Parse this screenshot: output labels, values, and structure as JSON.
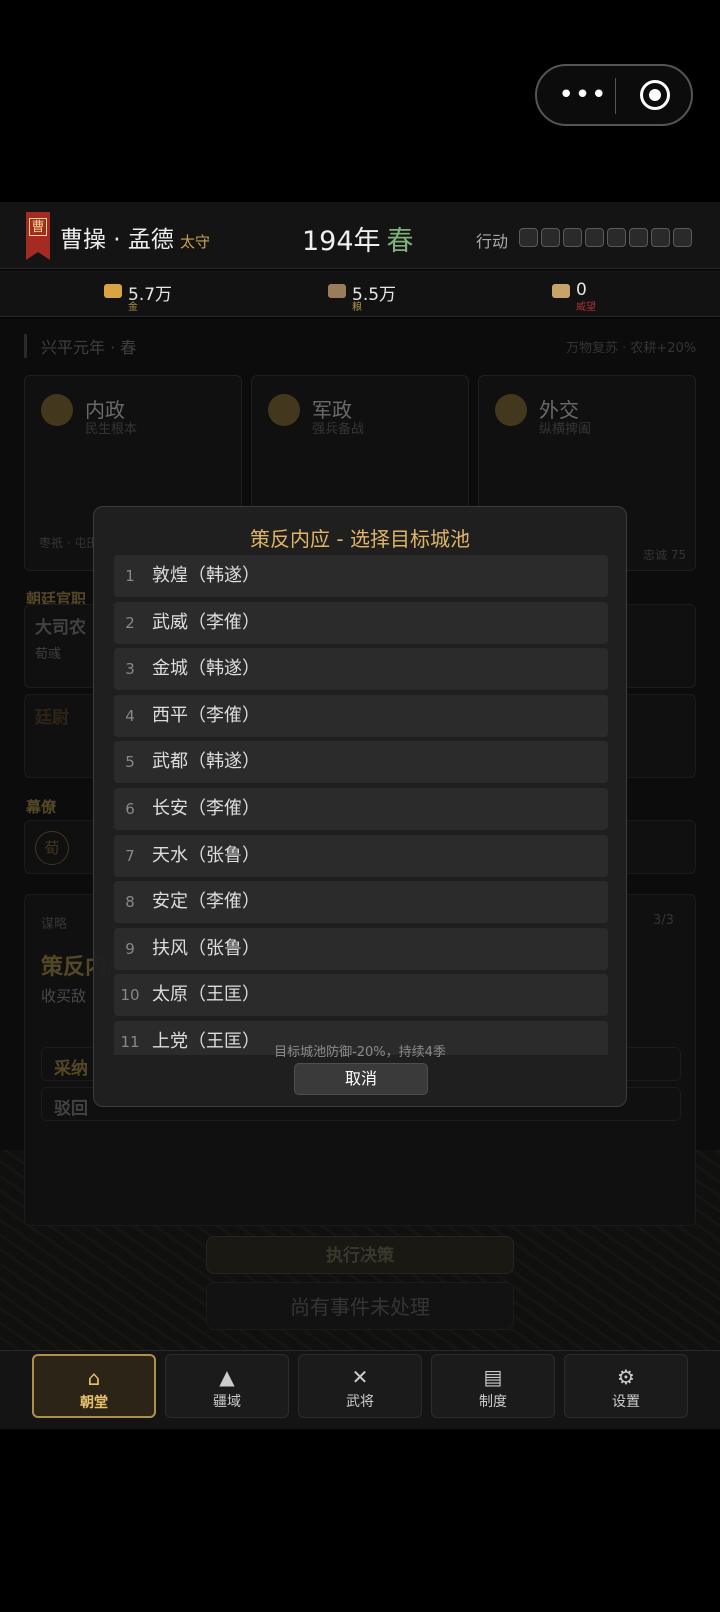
{
  "capsule": {
    "more_icon": "more-dots-icon",
    "close_icon": "target-circle-icon"
  },
  "header": {
    "banner_char": "曹",
    "ruler": "曹操 · 孟德",
    "rank": "太守",
    "year": "194年",
    "season": "春",
    "action_label": "行动",
    "action_pips_total": 8,
    "action_pips_used": 0
  },
  "resources": [
    {
      "icon": "gold-ingot-icon",
      "value": "5.7万",
      "label": "金",
      "color": "#d9a441"
    },
    {
      "icon": "granary-icon",
      "value": "5.5万",
      "label": "粮",
      "color": "#9a7b5a"
    },
    {
      "icon": "war-horse-icon",
      "value": "0",
      "label": "威望",
      "color": "#c7a36a"
    }
  ],
  "background": {
    "date": "兴平元年 · 春",
    "note": "万物复苏 · 农耕+20%",
    "cards": [
      {
        "title": "内政",
        "sub": "民生根本"
      },
      {
        "title": "军政",
        "sub": "强兵备战"
      },
      {
        "title": "外交",
        "sub": "纵横捭阖"
      }
    ],
    "card_foot_left": "枣祇 · 屯田",
    "card_foot_right": "忠诚 75",
    "officials_title": "朝廷官职",
    "official1": "大司农",
    "official1_person": "荀彧",
    "official2": "廷尉",
    "staff_title": "幕僚",
    "staff_name": "荀",
    "strategy_kicker": "谋略",
    "strategy_title": "策反内应",
    "strategy_desc": "收买敌",
    "strategy_count": "3/3",
    "accept": "采纳",
    "reject": "驳回",
    "execute": "执行决策",
    "pending": "尚有事件未处理"
  },
  "modal": {
    "title": "策反内应 - 选择目标城池",
    "items": [
      {
        "n": "1",
        "city": "敦煌（韩遂）"
      },
      {
        "n": "2",
        "city": "武威（李傕）"
      },
      {
        "n": "3",
        "city": "金城（韩遂）"
      },
      {
        "n": "4",
        "city": "西平（李傕）"
      },
      {
        "n": "5",
        "city": "武都（韩遂）"
      },
      {
        "n": "6",
        "city": "长安（李傕）"
      },
      {
        "n": "7",
        "city": "天水（张鲁）"
      },
      {
        "n": "8",
        "city": "安定（李傕）"
      },
      {
        "n": "9",
        "city": "扶风（张鲁）"
      },
      {
        "n": "10",
        "city": "太原（王匡）"
      },
      {
        "n": "11",
        "city": "上党（王匡）"
      }
    ],
    "hint": "目标城池防御-20%，持续4季",
    "cancel": "取消"
  },
  "tabs": [
    {
      "label": "朝堂",
      "icon": "palace-icon",
      "active": true
    },
    {
      "label": "疆域",
      "icon": "mountain-icon",
      "active": false
    },
    {
      "label": "武将",
      "icon": "crossed-swords-icon",
      "active": false
    },
    {
      "label": "制度",
      "icon": "scroll-icon",
      "active": false
    },
    {
      "label": "设置",
      "icon": "gear-icon",
      "active": false
    }
  ]
}
